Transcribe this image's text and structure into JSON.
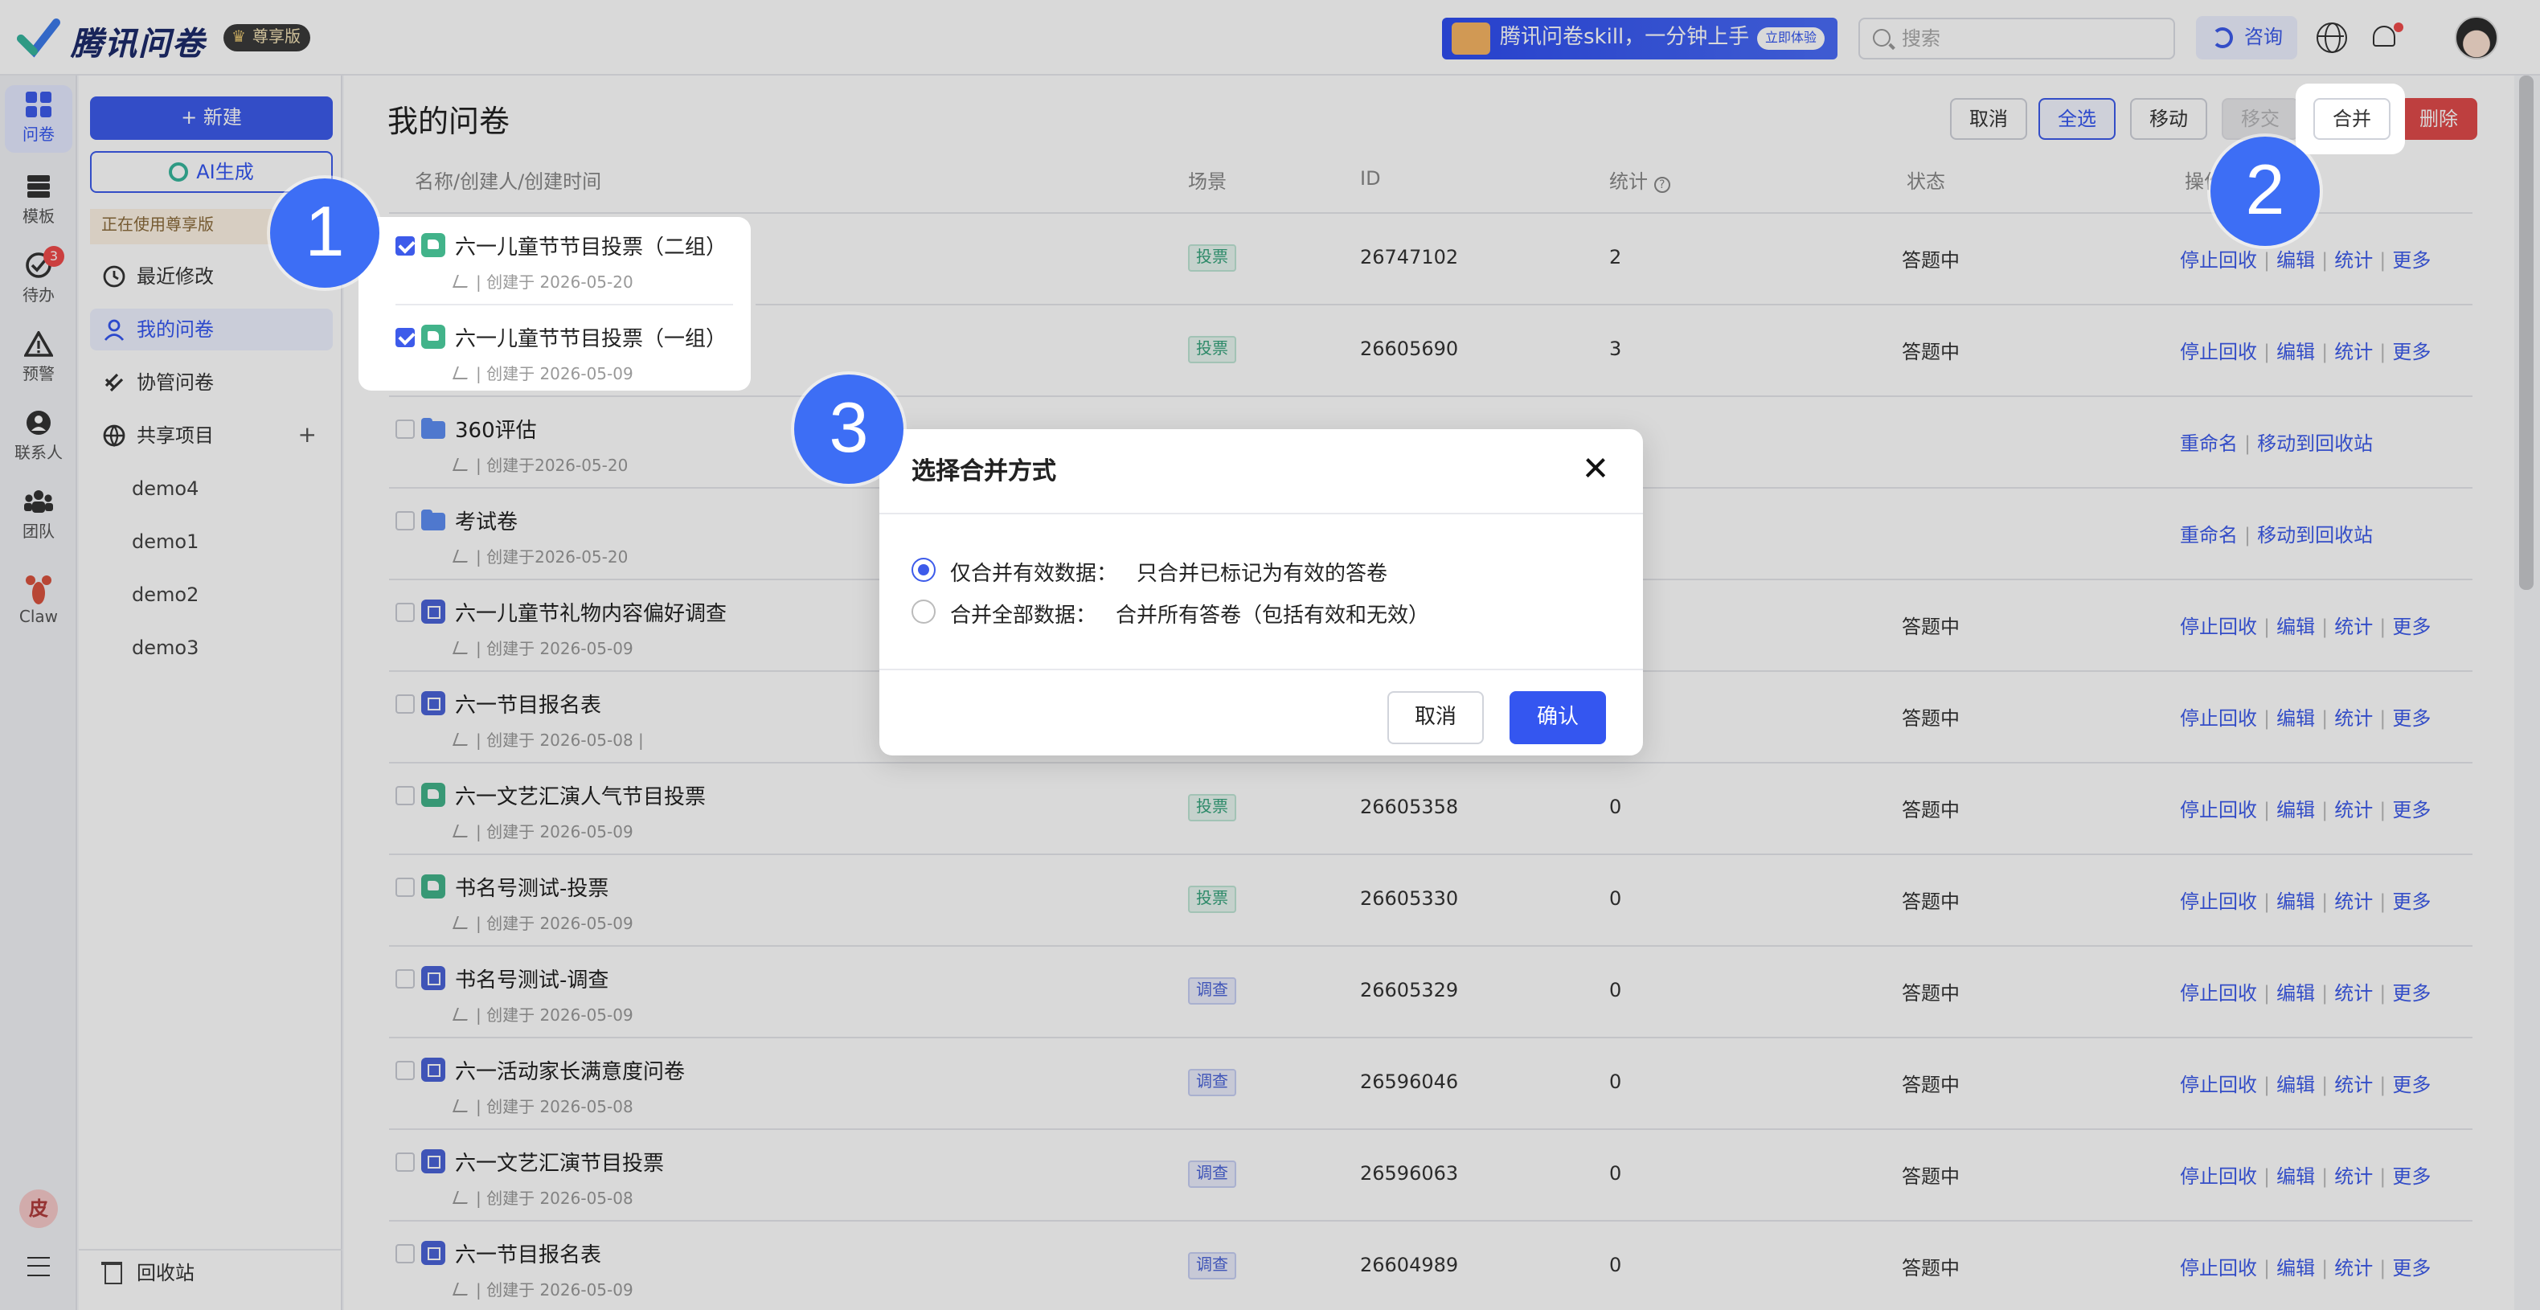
{
  "header": {
    "logo_text": "腾讯问卷",
    "edition": "尊享版",
    "promo_text": "腾讯问卷skill，一分钟上手",
    "promo_button": "立即体验",
    "search_placeholder": "搜索",
    "consult": "咨询"
  },
  "rail": {
    "items": [
      {
        "label": "问卷"
      },
      {
        "label": "模板"
      },
      {
        "label": "待办",
        "badge": "3"
      },
      {
        "label": "预警"
      },
      {
        "label": "联系人"
      },
      {
        "label": "团队"
      },
      {
        "label": "Claw"
      }
    ],
    "user_initial": "皮"
  },
  "sidebar": {
    "new_button": "+ 新建",
    "ai_button": "AI生成",
    "using_notice": "正在使用尊享版",
    "items": [
      {
        "label": "最近修改"
      },
      {
        "label": "我的问卷"
      },
      {
        "label": "协管问卷"
      },
      {
        "label": "共享项目"
      }
    ],
    "projects": [
      "demo4",
      "demo1",
      "demo2",
      "demo3"
    ],
    "recycle": "回收站"
  },
  "main": {
    "title": "我的问卷",
    "toolbar": {
      "cancel": "取消",
      "select_all": "全选",
      "move": "移动",
      "transfer": "移交",
      "merge": "合并",
      "delete": "删除"
    },
    "columns": [
      "名称/创建人/创建时间",
      "场景",
      "ID",
      "统计",
      "状态",
      "操作"
    ],
    "rows": [
      {
        "name": "六一儿童节节目投票（二组）",
        "meta": "| 创建于 2026-05-20",
        "type": "vote",
        "tag": "投票",
        "id": "26747102",
        "count": "2",
        "status": "答题中",
        "ops": [
          "停止回收",
          "编辑",
          "统计",
          "更多"
        ],
        "checked": true
      },
      {
        "name": "六一儿童节节目投票（一组）",
        "meta": "| 创建于 2026-05-09",
        "type": "vote",
        "tag": "投票",
        "id": "26605690",
        "count": "3",
        "status": "答题中",
        "ops": [
          "停止回收",
          "编辑",
          "统计",
          "更多"
        ],
        "checked": true
      },
      {
        "name": "360评估",
        "meta": "| 创建于2026-05-20",
        "type": "folder",
        "tag": "",
        "id": "",
        "count": "",
        "status": "",
        "ops": [
          "重命名",
          "移动到回收站"
        ],
        "checked": false
      },
      {
        "name": "考试卷",
        "meta": "| 创建于2026-05-20",
        "type": "folder",
        "tag": "",
        "id": "",
        "count": "",
        "status": "",
        "ops": [
          "重命名",
          "移动到回收站"
        ],
        "checked": false
      },
      {
        "name": "六一儿童节礼物内容偏好调查",
        "meta": "| 创建于 2026-05-09",
        "type": "survey",
        "tag": "",
        "id": "",
        "count": "",
        "status": "答题中",
        "ops": [
          "停止回收",
          "编辑",
          "统计",
          "更多"
        ],
        "checked": false
      },
      {
        "name": "六一节目报名表",
        "meta": "| 创建于 2026-05-08 |",
        "type": "survey",
        "tag": "",
        "id": "",
        "count": "",
        "status": "答题中",
        "ops": [
          "停止回收",
          "编辑",
          "统计",
          "更多"
        ],
        "checked": false
      },
      {
        "name": "六一文艺汇演人气节目投票",
        "meta": "| 创建于 2026-05-09",
        "type": "vote",
        "tag": "投票",
        "id": "26605358",
        "count": "0",
        "status": "答题中",
        "ops": [
          "停止回收",
          "编辑",
          "统计",
          "更多"
        ],
        "checked": false
      },
      {
        "name": "书名号测试-投票",
        "meta": "| 创建于 2026-05-09",
        "type": "vote",
        "tag": "投票",
        "id": "26605330",
        "count": "0",
        "status": "答题中",
        "ops": [
          "停止回收",
          "编辑",
          "统计",
          "更多"
        ],
        "checked": false
      },
      {
        "name": "书名号测试-调查",
        "meta": "| 创建于 2026-05-09",
        "type": "survey",
        "tag": "调查",
        "id": "26605329",
        "count": "0",
        "status": "答题中",
        "ops": [
          "停止回收",
          "编辑",
          "统计",
          "更多"
        ],
        "checked": false
      },
      {
        "name": "六一活动家长满意度问卷",
        "meta": "| 创建于 2026-05-08",
        "type": "survey",
        "tag": "调查",
        "id": "26596046",
        "count": "0",
        "status": "答题中",
        "ops": [
          "停止回收",
          "编辑",
          "统计",
          "更多"
        ],
        "checked": false
      },
      {
        "name": "六一文艺汇演节目投票",
        "meta": "| 创建于 2026-05-08",
        "type": "survey",
        "tag": "调查",
        "id": "26596063",
        "count": "0",
        "status": "答题中",
        "ops": [
          "停止回收",
          "编辑",
          "统计",
          "更多"
        ],
        "checked": false
      },
      {
        "name": "六一节目报名表",
        "meta": "| 创建于 2026-05-09",
        "type": "survey",
        "tag": "调查",
        "id": "26604989",
        "count": "0",
        "status": "答题中",
        "ops": [
          "停止回收",
          "编辑",
          "统计",
          "更多"
        ],
        "checked": false
      }
    ]
  },
  "dialog": {
    "title": "选择合并方式",
    "options": [
      {
        "label": "仅合并有效数据：",
        "desc": "只合并已标记为有效的答卷",
        "selected": true
      },
      {
        "label": "合并全部数据：",
        "desc": "合并所有答卷（包括有效和无效）",
        "selected": false
      }
    ],
    "cancel": "取消",
    "confirm": "确认"
  },
  "callouts": [
    "1",
    "2",
    "3"
  ],
  "colors": {
    "primary": "#3d5bea",
    "danger": "#e04a4a",
    "vote": "#42b38a",
    "survey": "#4a63d8"
  }
}
